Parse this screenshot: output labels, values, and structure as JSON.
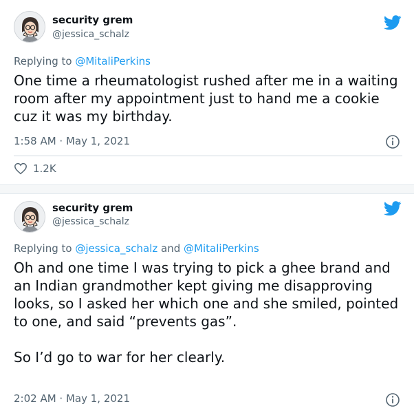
{
  "tweets": [
    {
      "author_name": "security grem",
      "handle": "@jessica_schalz",
      "replying_prefix": "Replying to ",
      "replying_to": [
        "@MitaliPerkins"
      ],
      "text": "One time a rheumatologist rushed after me in a waiting room after my appointment just to hand me a cookie cuz it was my birthday.",
      "timestamp": "1:58 AM · May 1, 2021",
      "likes": "1.2K",
      "icons": [
        "twitter-bird-icon",
        "info-icon",
        "heart-icon"
      ]
    },
    {
      "author_name": "security grem",
      "handle": "@jessica_schalz",
      "replying_prefix": "Replying to ",
      "replying_to": [
        "@jessica_schalz",
        "@MitaliPerkins"
      ],
      "replying_joiner": " and ",
      "text": "Oh and one time I was trying to pick a ghee brand and an Indian grandmother kept giving me disapproving looks, so I asked her which one and she smiled, pointed to one, and said “prevents gas”.\n\nSo I’d go to war for her clearly.",
      "timestamp": "2:02 AM · May 1, 2021",
      "icons": [
        "twitter-bird-icon",
        "info-icon"
      ]
    }
  ],
  "colors": {
    "link": "#1d9bf0",
    "text": "#0f1419",
    "secondary": "#536471",
    "separator": "#f5f7f8"
  }
}
